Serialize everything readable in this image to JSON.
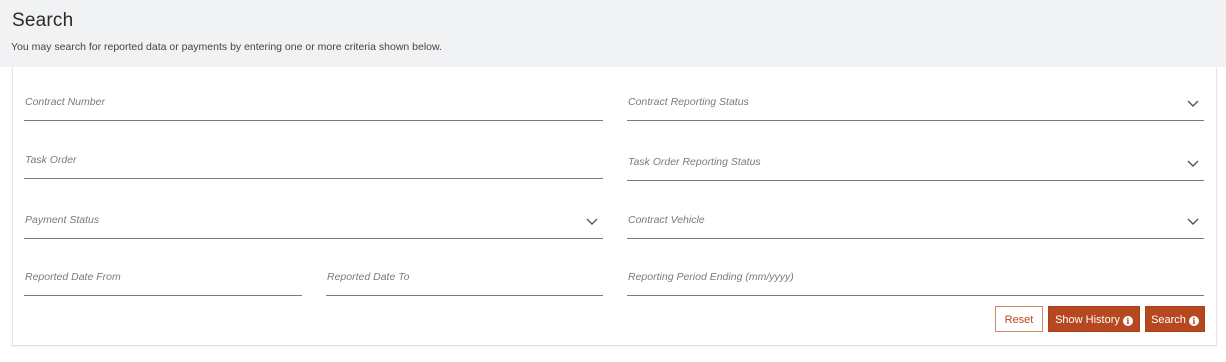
{
  "header": {
    "title": "Search",
    "subtitle": "You may search for reported data or payments by entering one or more criteria shown below."
  },
  "fields": {
    "contract_number": "Contract Number",
    "contract_reporting_status": "Contract Reporting Status",
    "task_order": "Task Order",
    "task_order_reporting_status": "Task Order Reporting Status",
    "payment_status": "Payment Status",
    "contract_vehicle": "Contract Vehicle",
    "reported_date_from": "Reported Date From",
    "reported_date_to": "Reported Date To",
    "reporting_period_ending": "Reporting Period Ending (mm/yyyy)"
  },
  "buttons": {
    "reset": "Reset",
    "show_history": "Show History",
    "search": "Search",
    "info_glyph": "i"
  },
  "colors": {
    "accent": "#b5481f",
    "header_bg": "#f1f2f4"
  }
}
